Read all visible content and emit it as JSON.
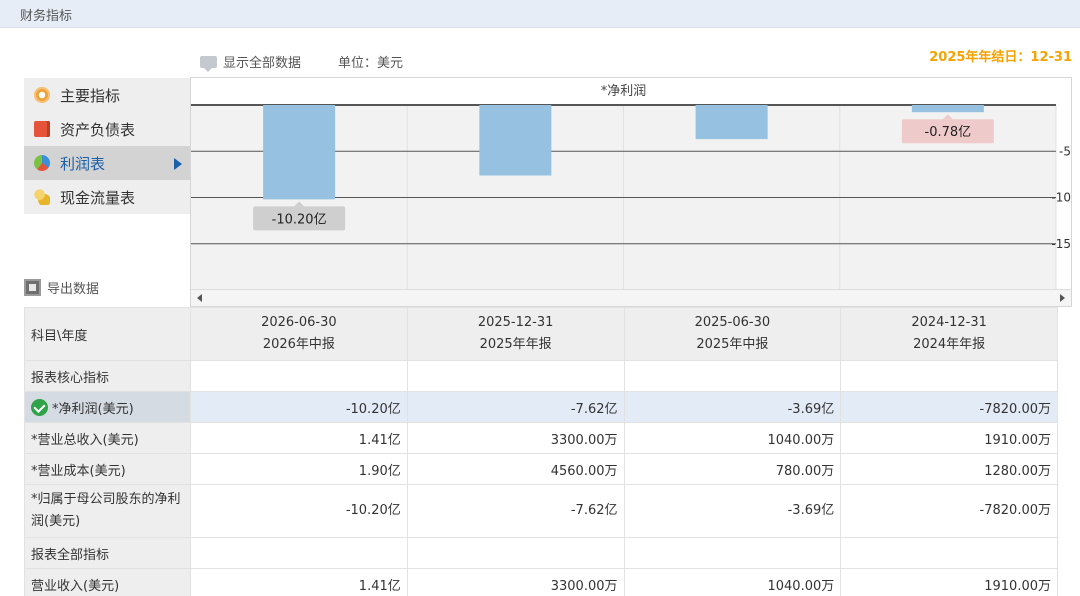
{
  "header": {
    "title": "财务指标"
  },
  "toolbar": {
    "show_all": "显示全部数据",
    "unit": "单位：美元",
    "fiscal_year_end": "2025年年结日：12-31"
  },
  "nav": {
    "items": [
      {
        "label": "主要指标",
        "icon": "gear-icon"
      },
      {
        "label": "资产负债表",
        "icon": "document-icon"
      },
      {
        "label": "利润表",
        "icon": "pie-chart-icon",
        "active": true
      },
      {
        "label": "现金流量表",
        "icon": "coins-icon"
      }
    ]
  },
  "export": {
    "label": "导出数据"
  },
  "chart_data": {
    "type": "bar",
    "title": "*净利润",
    "categories": [
      "2026-06-30",
      "2025-12-31",
      "2025-06-30",
      "2024-12-31"
    ],
    "values": [
      -10.2,
      -7.62,
      -3.69,
      -0.78
    ],
    "ylim": [
      -20,
      0
    ],
    "yticks": [
      -5,
      -10,
      -15
    ],
    "ytick_labels": [
      "-5",
      "-10",
      "-15"
    ],
    "grid": true,
    "colors": {
      "bar": "#96c1e0"
    },
    "annotations": [
      {
        "index": 0,
        "text": "-10.20亿",
        "color": "#cfcfcf"
      },
      {
        "index": 3,
        "text": "-0.78亿",
        "color": "#efcaca"
      }
    ]
  },
  "table": {
    "corner": "科目\\年度",
    "columns": [
      {
        "date": "2026-06-30",
        "type": "2026年中报"
      },
      {
        "date": "2025-12-31",
        "type": "2025年年报"
      },
      {
        "date": "2025-06-30",
        "type": "2025年中报"
      },
      {
        "date": "2024-12-31",
        "type": "2024年年报"
      }
    ],
    "section_core": "报表核心指标",
    "rows_core": [
      {
        "label": "*净利润(美元)",
        "values": [
          "-10.20亿",
          "-7.62亿",
          "-3.69亿",
          "-7820.00万"
        ],
        "highlight": true
      },
      {
        "label": "*营业总收入(美元)",
        "values": [
          "1.41亿",
          "3300.00万",
          "1040.00万",
          "1910.00万"
        ]
      },
      {
        "label": "*营业成本(美元)",
        "values": [
          "1.90亿",
          "4560.00万",
          "780.00万",
          "1280.00万"
        ]
      },
      {
        "label": "*归属于母公司股东的净利润(美元)",
        "values": [
          "-10.20亿",
          "-7.62亿",
          "-3.69亿",
          "-7820.00万"
        ]
      }
    ],
    "section_all": "报表全部指标",
    "rows_all": [
      {
        "label": "营业收入(美元)",
        "values": [
          "1.41亿",
          "3300.00万",
          "1040.00万",
          "1910.00万"
        ]
      }
    ]
  }
}
